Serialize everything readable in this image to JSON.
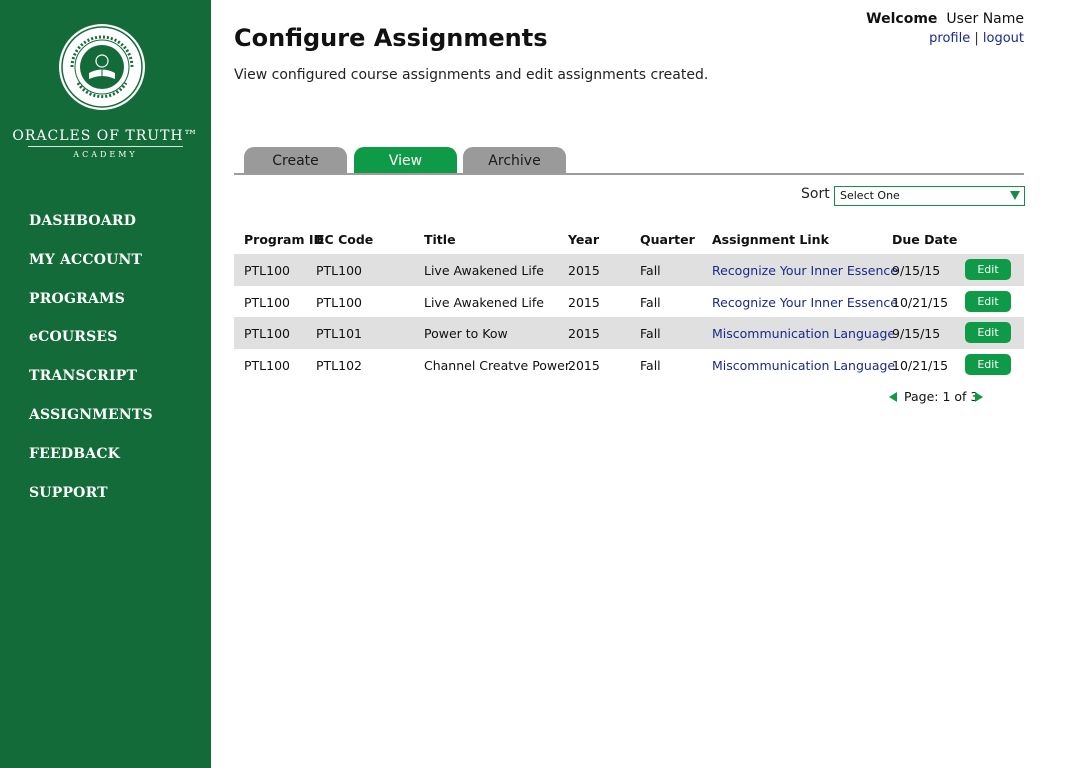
{
  "brand": {
    "name": "ORACLES OF TRUTH™",
    "sub": "ACADEMY"
  },
  "nav": [
    {
      "label": "DASHBOARD"
    },
    {
      "label": "MY ACCOUNT"
    },
    {
      "label": "PROGRAMS"
    },
    {
      "label": "eCOURSES"
    },
    {
      "label": "TRANSCRIPT"
    },
    {
      "label": "ASSIGNMENTS"
    },
    {
      "label": "FEEDBACK"
    },
    {
      "label": "SUPPORT"
    }
  ],
  "header": {
    "title": "Configure Assignments",
    "description": "View configured course assignments and edit assignments created.",
    "welcome_label": "Welcome",
    "user_name": "User Name",
    "profile_link": "profile",
    "separator": "|",
    "logout_link": "logout"
  },
  "tabs": [
    {
      "label": "Create",
      "active": false
    },
    {
      "label": "View",
      "active": true
    },
    {
      "label": "Archive",
      "active": false
    }
  ],
  "sort": {
    "label": "Sort",
    "selected": "Select One"
  },
  "table": {
    "headers": [
      "Program ID",
      "EC Code",
      "Title",
      "Year",
      "Quarter",
      "Assignment Link",
      "Due Date"
    ],
    "rows": [
      {
        "program_id": "PTL100",
        "ec_code": "PTL100",
        "title": "Live Awakened Life",
        "year": "2015",
        "quarter": "Fall",
        "link": "Recognize Your Inner Essence",
        "due": "9/15/15",
        "edit": "Edit"
      },
      {
        "program_id": "PTL100",
        "ec_code": "PTL100",
        "title": "Live Awakened Life",
        "year": "2015",
        "quarter": "Fall",
        "link": "Recognize Your Inner Essence",
        "due": "10/21/15",
        "edit": "Edit"
      },
      {
        "program_id": "PTL100",
        "ec_code": "PTL101",
        "title": "Power to Kow",
        "year": "2015",
        "quarter": "Fall",
        "link": "Miscommunication Language",
        "due": "9/15/15",
        "edit": "Edit"
      },
      {
        "program_id": "PTL100",
        "ec_code": "PTL102",
        "title": "Channel Creatve Power",
        "year": "2015",
        "quarter": "Fall",
        "link": "Miscommunication Language",
        "due": "10/21/15",
        "edit": "Edit"
      }
    ]
  },
  "pagination": {
    "text": "Page: 1 of 3"
  },
  "icons": {
    "logo": "academy-seal-icon",
    "prev": "triangle-left-icon",
    "next": "triangle-right-icon",
    "dropdown": "triangle-down-icon"
  },
  "colors": {
    "sidebar": "#146b3a",
    "accent": "#0f9a47",
    "tab_inactive": "#9a9a9a",
    "link": "#1a2a8a",
    "row_shade": "#e0e0e0"
  }
}
